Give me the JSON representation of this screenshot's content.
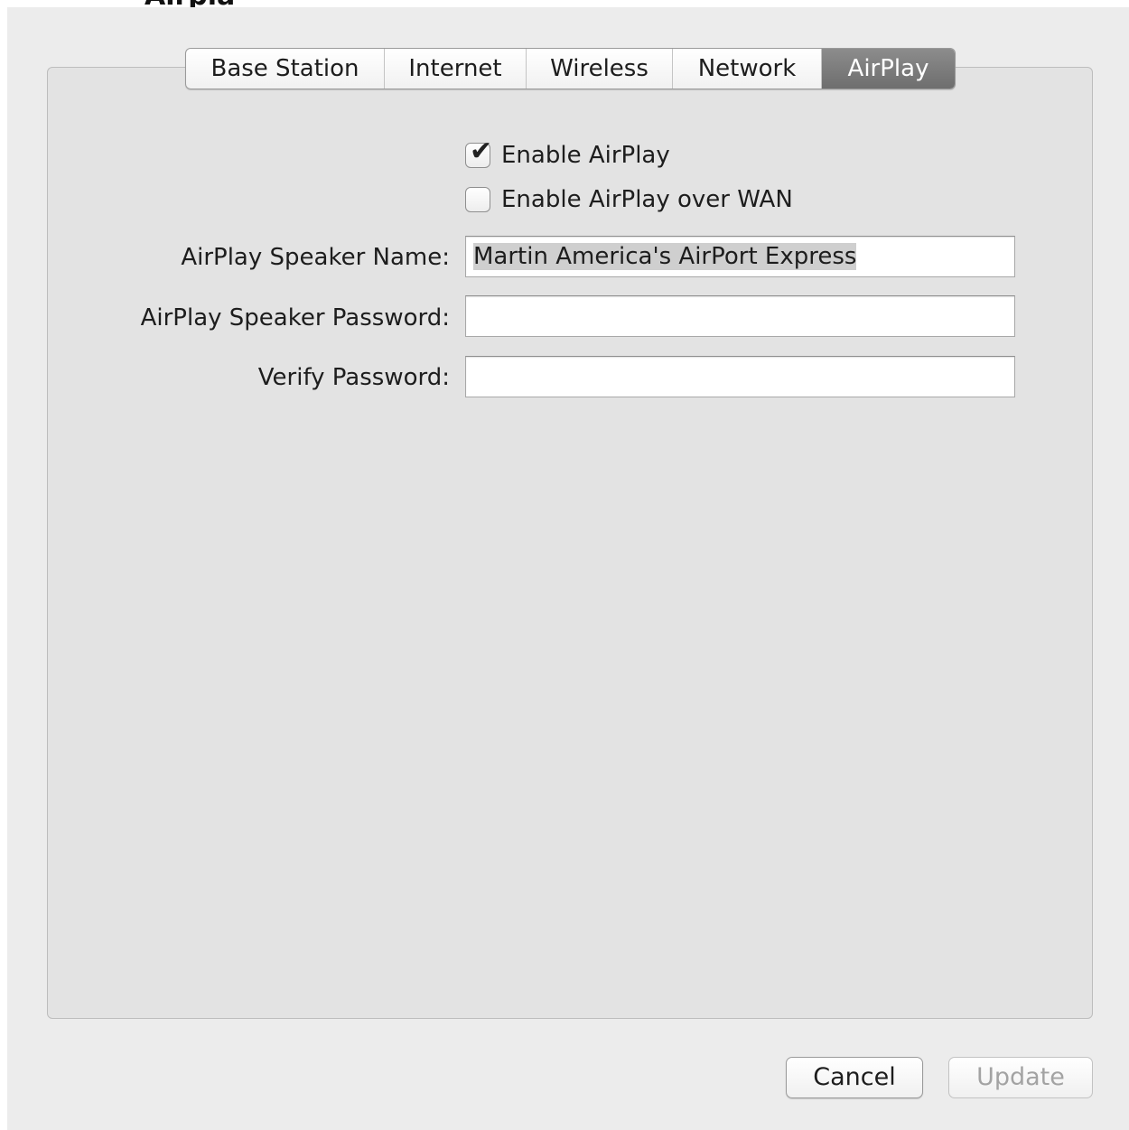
{
  "window_title_fragment": "Airplay",
  "tabs": [
    {
      "label": "Base Station",
      "selected": false
    },
    {
      "label": "Internet",
      "selected": false
    },
    {
      "label": "Wireless",
      "selected": false
    },
    {
      "label": "Network",
      "selected": false
    },
    {
      "label": "AirPlay",
      "selected": true
    }
  ],
  "airplay": {
    "enable_airplay": {
      "label": "Enable AirPlay",
      "checked": true
    },
    "enable_airplay_wan": {
      "label": "Enable AirPlay over WAN",
      "checked": false
    },
    "speaker_name": {
      "label": "AirPlay Speaker Name:",
      "value": "Martin America's AirPort Express"
    },
    "speaker_password": {
      "label": "AirPlay Speaker Password:",
      "value": ""
    },
    "verify_password": {
      "label": "Verify Password:",
      "value": ""
    }
  },
  "buttons": {
    "cancel": "Cancel",
    "update": "Update"
  },
  "colors": {
    "selected_tab": "#7d7d7d",
    "panel_bg": "#e3e3e3",
    "window_bg": "#ececec"
  }
}
